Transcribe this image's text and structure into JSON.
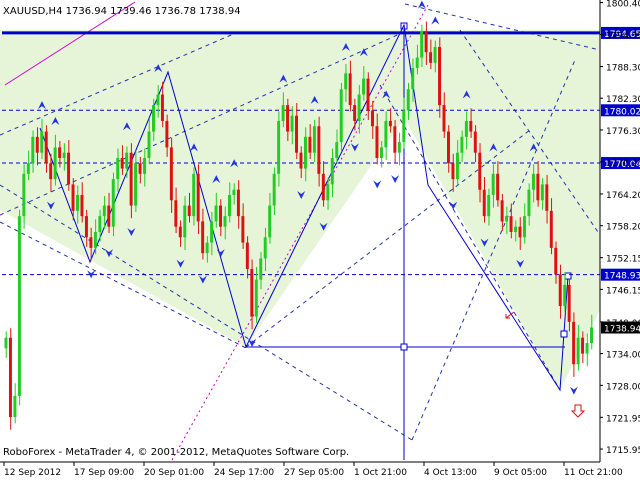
{
  "window": {
    "symbol_info": "XAUUSD,H4  1736.94 1739.46 1736.78 1738.94",
    "copyright": "RoboForex - MetaTrader 4, © 2001-2012, MetaQuotes Software Corp."
  },
  "colors": {
    "background": "#ffffff",
    "triangle_fill": "#e6f5d8",
    "bull_candle": "#22cc22",
    "bear_candle": "#dd1111",
    "trend_blue": "#0000cc",
    "magenta": "#cc00cc",
    "fractal_arrow": "#2233dd",
    "current_price_box": "#000000"
  },
  "chart_data": {
    "type": "candlestick",
    "symbol": "XAUUSD",
    "timeframe": "H4",
    "title": "XAUUSD,H4  1736.94 1739.46 1736.78 1738.94",
    "ohlc_current": {
      "open": 1736.94,
      "high": 1739.46,
      "low": 1736.78,
      "close": 1738.94
    },
    "ylim": [
      1713.5,
      1800.5
    ],
    "y_ticks": [
      1715.95,
      1721.95,
      1728.0,
      1734.0,
      1740.0,
      1746.15,
      1752.15,
      1758.2,
      1764.2,
      1770.25,
      1776.3,
      1782.3,
      1788.3,
      1794.35,
      1800.4
    ],
    "x_labels": [
      "12 Sep 2012",
      "17 Sep 09:00",
      "20 Sep 01:00",
      "24 Sep 17:00",
      "27 Sep 05:00",
      "1 Oct 21:00",
      "4 Oct 13:00",
      "9 Oct 05:00",
      "11 Oct 21:00"
    ],
    "levels": [
      {
        "value": 1794.65,
        "label": "1794.65",
        "style": "solid"
      },
      {
        "value": 1780.02,
        "label": "1780.02",
        "style": "dashed"
      },
      {
        "value": 1770.04,
        "label": "1770.04",
        "style": "dashed"
      },
      {
        "value": 1748.93,
        "label": "1748.93",
        "style": "dashed"
      },
      {
        "value": 1738.94,
        "label": "1738.94",
        "style": "current"
      }
    ],
    "candles_close": [
      1737,
      1722,
      1726,
      1760,
      1768,
      1770,
      1775,
      1772,
      1776,
      1770,
      1767,
      1773,
      1771,
      1772,
      1766,
      1761,
      1764,
      1760,
      1756,
      1754,
      1757,
      1760,
      1762,
      1758,
      1767,
      1771,
      1769,
      1772,
      1762,
      1770,
      1768,
      1771,
      1776,
      1781,
      1783,
      1778,
      1773,
      1763,
      1758,
      1756,
      1762,
      1760,
      1768,
      1759,
      1753,
      1755,
      1759,
      1762,
      1758,
      1760,
      1764,
      1765,
      1760,
      1755,
      1750,
      1741,
      1748,
      1752,
      1756,
      1762,
      1768,
      1778,
      1781,
      1776,
      1779,
      1772,
      1769,
      1775,
      1772,
      1777,
      1768,
      1763,
      1766,
      1771,
      1774,
      1784,
      1787,
      1781,
      1778,
      1783,
      1786,
      1780,
      1777,
      1771,
      1773,
      1778,
      1777,
      1772,
      1774,
      1780,
      1784,
      1788,
      1790,
      1795,
      1791,
      1789,
      1792,
      1781,
      1776,
      1770,
      1767,
      1772,
      1775,
      1778,
      1776,
      1772,
      1765,
      1760,
      1764,
      1768,
      1763,
      1759,
      1760,
      1757,
      1758,
      1756,
      1760,
      1765,
      1768,
      1763,
      1766,
      1761,
      1754,
      1749,
      1743,
      1747,
      1740,
      1732,
      1737,
      1734,
      1736,
      1738.94
    ],
    "candles_open_first": 1735
  }
}
